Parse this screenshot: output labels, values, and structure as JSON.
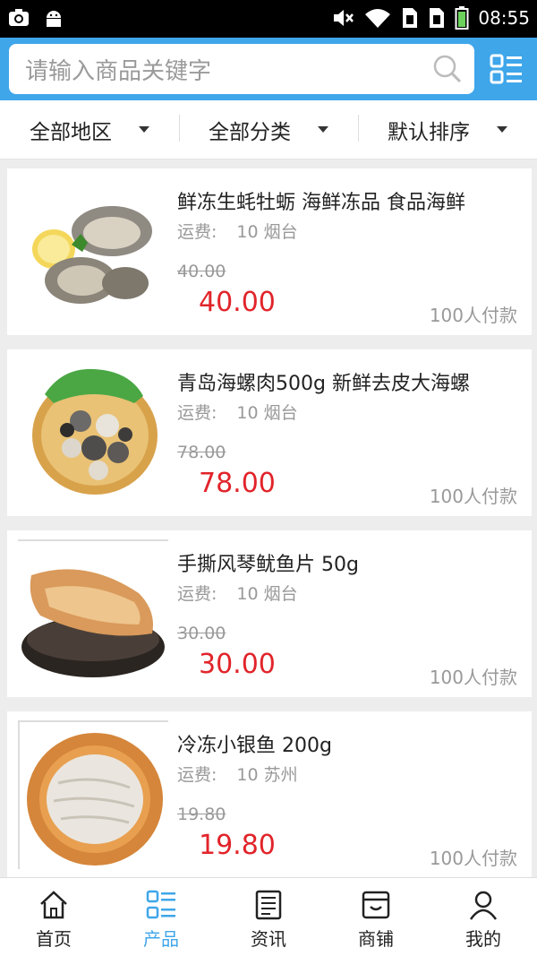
{
  "status": {
    "time": "08:55"
  },
  "search": {
    "placeholder": "请输入商品关键字"
  },
  "filters": [
    {
      "label": "全部地区"
    },
    {
      "label": "全部分类"
    },
    {
      "label": "默认排序"
    }
  ],
  "products": [
    {
      "title": "鲜冻生蚝牡蛎 海鲜冻品 食品海鲜",
      "ship_label": "运费:",
      "ship_value": "10 烟台",
      "old_price": "40.00",
      "price": "40.00",
      "sold": "100人付款",
      "image": "oysters"
    },
    {
      "title": "青岛海螺肉500g 新鲜去皮大海螺",
      "ship_label": "运费:",
      "ship_value": "10 烟台",
      "old_price": "78.00",
      "price": "78.00",
      "sold": "100人付款",
      "image": "conch-meat"
    },
    {
      "title": "手撕风琴鱿鱼片 50g",
      "ship_label": "运费:",
      "ship_value": "10 烟台",
      "old_price": "30.00",
      "price": "30.00",
      "sold": "100人付款",
      "image": "squid-slice"
    },
    {
      "title": "冷冻小银鱼 200g",
      "ship_label": "运费:",
      "ship_value": "10 苏州",
      "old_price": "19.80",
      "price": "19.80",
      "sold": "100人付款",
      "image": "whitebait"
    }
  ],
  "tabs": [
    {
      "label": "首页",
      "icon": "home-icon"
    },
    {
      "label": "产品",
      "icon": "product-list-icon"
    },
    {
      "label": "资讯",
      "icon": "news-icon"
    },
    {
      "label": "商铺",
      "icon": "shop-icon"
    },
    {
      "label": "我的",
      "icon": "user-icon"
    }
  ],
  "colors": {
    "accent": "#3fa6ea",
    "price": "#e1242a"
  }
}
